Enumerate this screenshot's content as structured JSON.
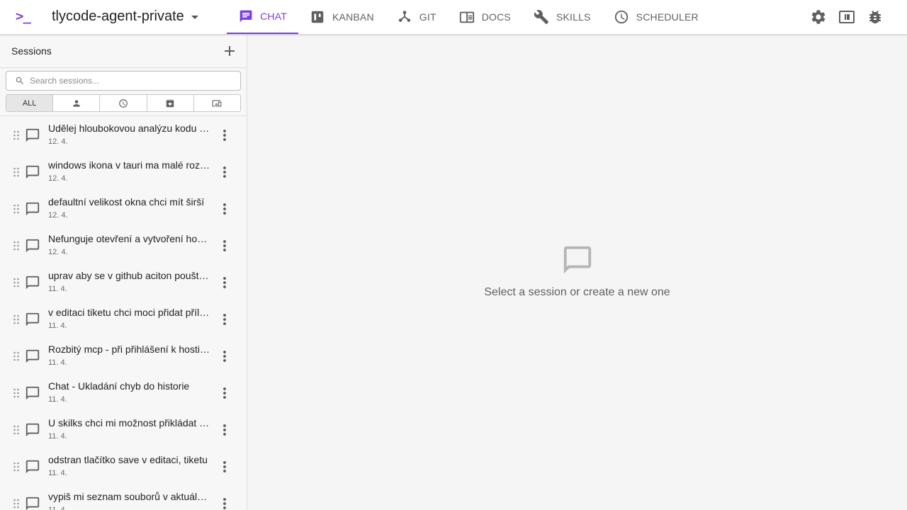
{
  "colors": {
    "accent": "#7b3fe4",
    "icon": "#5f5f5f",
    "sidebar_bg": "#f7f7f7",
    "main_bg": "#f5f5f5"
  },
  "header": {
    "logo": ">_",
    "project_name": "tlycode-agent-private",
    "tabs": [
      {
        "label": "CHAT",
        "icon": "chat-icon",
        "active": true
      },
      {
        "label": "KANBAN",
        "icon": "kanban-icon",
        "active": false
      },
      {
        "label": "GIT",
        "icon": "git-icon",
        "active": false
      },
      {
        "label": "DOCS",
        "icon": "docs-icon",
        "active": false
      },
      {
        "label": "SKILLS",
        "icon": "wrench-icon",
        "active": false
      },
      {
        "label": "SCHEDULER",
        "icon": "clock-icon",
        "active": false
      }
    ],
    "actions": [
      "settings-icon",
      "panel-toggle-icon",
      "bug-icon"
    ]
  },
  "sidebar": {
    "title": "Sessions",
    "search_placeholder": "Search sessions...",
    "filters": [
      {
        "label": "ALL",
        "active": true
      },
      {
        "icon": "person-icon"
      },
      {
        "icon": "clock-icon"
      },
      {
        "icon": "archive-icon"
      },
      {
        "icon": "devices-icon"
      }
    ],
    "sessions": [
      {
        "title": "Udělej hloubokovou analýzu kodu a najdi možné problémy",
        "date": "12. 4."
      },
      {
        "title": "windows ikona v tauri ma malé rozlišení",
        "date": "12. 4."
      },
      {
        "title": "defaultní velikost okna chci mít širší",
        "date": "12. 4."
      },
      {
        "title": "Nefunguje otevření a vytvoření hostitele",
        "date": "12. 4."
      },
      {
        "title": "uprav aby se v github aciton pouštěly testy",
        "date": "11. 4."
      },
      {
        "title": "v editaci tiketu chci moci přidat přílohu",
        "date": "11. 4."
      },
      {
        "title": "Rozbitý mcp - při přihlášení k hostiteli",
        "date": "11. 4."
      },
      {
        "title": "Chat - Ukladání chyb do historie",
        "date": "11. 4."
      },
      {
        "title": "U skilks chci mi možnost přikládat soubory",
        "date": "11. 4."
      },
      {
        "title": "odstran tlačítko save v editaci, tiketu",
        "date": "11. 4."
      },
      {
        "title": "vypiš mi seznam souborů v aktuálním adresáři",
        "date": "11. 4."
      }
    ]
  },
  "main": {
    "empty_icon": "chat-bubble-icon",
    "empty_text": "Select a session or create a new one"
  }
}
